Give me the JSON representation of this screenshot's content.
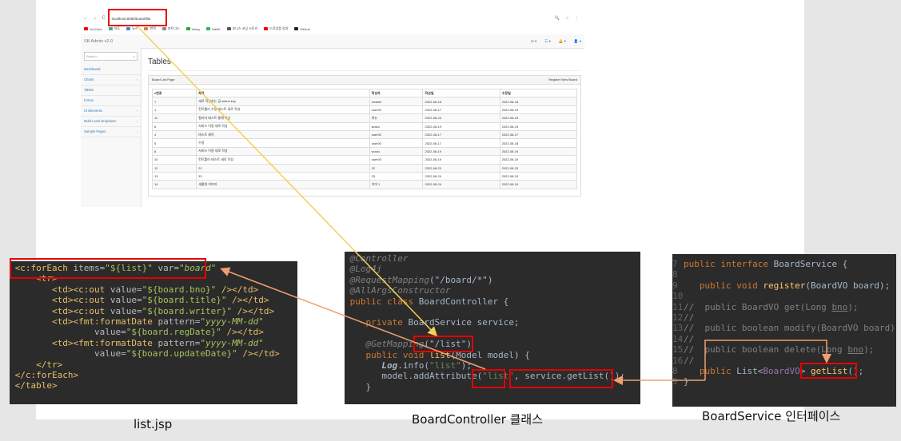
{
  "browser": {
    "url": "localhost:8080/board/list",
    "bookmarks": [
      "YouTube",
      "지도",
      "뉴스",
      "번역",
      "파트너스",
      "Velog",
      "Tab59",
      "부니스 코딩 스토리",
      "드로잉랩 강좌",
      "GitHub"
    ],
    "brand": "SB Admin v2.0",
    "header_icons": [
      "✉ ▾",
      "☰ ▾",
      "🔔 ▾",
      "👤 ▾"
    ],
    "search_placeholder": "Search...",
    "sidebar": [
      {
        "label": "Dashboard",
        "icon": "dashboard-icon",
        "arrow": ""
      },
      {
        "label": "Charts",
        "icon": "chart-icon",
        "arrow": "‹"
      },
      {
        "label": "Tables",
        "icon": "table-icon",
        "arrow": ""
      },
      {
        "label": "Forms",
        "icon": "form-icon",
        "arrow": ""
      },
      {
        "label": "UI Elements",
        "icon": "wrench-icon",
        "arrow": "‹"
      },
      {
        "label": "Multi-Level Dropdown",
        "icon": "sitemap-icon",
        "arrow": "‹"
      },
      {
        "label": "Sample Pages",
        "icon": "files-icon",
        "arrow": "‹"
      }
    ],
    "page_title": "Tables",
    "panel_title": "Board List Page",
    "register_label": "Register New Board",
    "table": {
      "headers": [
        "#번호",
        "제목",
        "작성자",
        "작성일",
        "수정일"
      ],
      "rows": [
        [
          "7",
          "새로 작성하는 글 select key",
          "newbie",
          "2022-08-18",
          "2022-08-18"
        ],
        [
          "1",
          "컨트롤러 수정 테스트 새로 작성",
          "user00",
          "2022-08-17",
          "2022-08-19"
        ],
        [
          "11",
          "컬러서 테스트 통해 최신 ",
          "워뉴",
          "2022-08-23",
          "2022-08-23"
        ],
        [
          "6",
          "서비스 이용 새로 작성",
          "wuwu",
          "2022-08-19",
          "2022-08-19"
        ],
        [
          "4",
          "테스트 제목",
          "user00",
          "2022-08-17",
          "2022-08-17"
        ],
        [
          "5",
          "수정",
          "user00",
          "2022-08-17",
          "2022-08-18"
        ],
        [
          "8",
          "서비스 이용 새로 작성",
          "wuwu",
          "2022-08-19",
          "2022-08-19"
        ],
        [
          "10",
          "컨트롤러 테스트 새로 작성",
          "user00",
          "2022-08-19",
          "2022-08-19"
        ],
        [
          "12",
          "22",
          "22",
          "2022-08-23",
          "2022-08-23"
        ],
        [
          "13",
          "33",
          "33",
          "2022-08-24",
          "2022-08-24"
        ],
        [
          "14",
          "새롭게 이미지",
          "이미 1",
          "2022-08-24",
          "2022-08-24"
        ]
      ]
    }
  },
  "jsp_code": {
    "l1_tag": "<c:forEach",
    "l1_a1": " items=",
    "l1_v1": "\"${list}\"",
    "l1_a2": " var=",
    "l1_v2": "\"board\"",
    "l2": "<tr>",
    "l3_tag": "<td><c:out",
    "l3_attr": " value=",
    "l3_val": "\"${board.bno}\"",
    "l3_end": " /></td>",
    "l4_val": "\"${board.title}\"",
    "l5_val": "\"${board.writer}\"",
    "l6_tag": "<td><fmt:formatDate",
    "l6_attr": " pattern=",
    "l6_val": "\"yyyy-MM-dd\"",
    "l7_attr": "value=",
    "l7_val": "\"${board.regDate}\"",
    "l7_end": " /></td>",
    "l9_val": "\"${board.updateDate}\"",
    "l9_end": " /></td>",
    "l10": "</tr>",
    "l11": "</c:forEach>",
    "l12": "</table>"
  },
  "controller_code": {
    "l1": "@Controller",
    "l2": "@Log4j",
    "l3_ann": "@RequestMapping",
    "l3_str": "(\"/board/*\")",
    "l4": "@AllArgsConstructor",
    "l5_kw": "public class ",
    "l5_name": "BoardController {",
    "l7_kw": "private ",
    "l7_rest": "BoardService service;",
    "l9_ann": "@GetMapping",
    "l9_str": "(\"/list\")",
    "l10_kw": "public void ",
    "l10_fn": "list",
    "l10_rest": "(Model model) {",
    "l11_log": "Log",
    "l11_mid": ".info(",
    "l11_str": "\"list\"",
    "l11_end": ");",
    "l12_a": "model.addAttribute(",
    "l12_str": "\"list\"",
    "l12_b": ", service.getList());",
    "l13": "}"
  },
  "service_code": {
    "lines": [
      "7",
      "8",
      "9",
      "10",
      "11",
      "12",
      "13",
      "14",
      "15",
      "16",
      "8",
      "9"
    ],
    "l7_kw": "public interface ",
    "l7_name": "BoardService {",
    "l9_kw": "public void ",
    "l9_fn": "register",
    "l9_rest": "(BoardVO board);",
    "l11": "//  public BoardVO get(Long ",
    "l11_u": "bno",
    "l11_end": ");",
    "l12": "//",
    "l13": "//  public boolean modify(BoardVO board);",
    "l14": "//",
    "l15": "//  public boolean delete(Long ",
    "l15_u": "bno",
    "l15_end": ");",
    "l16": "//",
    "l17_kw": "public ",
    "l17_type": "List<",
    "l17_vo": "BoardVO",
    "l17_gt": "> ",
    "l17_fn": "getList",
    "l17_end": "();",
    "l18": "}"
  },
  "captions": {
    "jsp": "list.jsp",
    "controller": "BoardController 클래스",
    "service": "BoardService 인터페이스"
  },
  "colors": {
    "highlight": "#e60000",
    "arrow_yellow": "#f2d05a",
    "arrow_orange": "#f0a070"
  }
}
